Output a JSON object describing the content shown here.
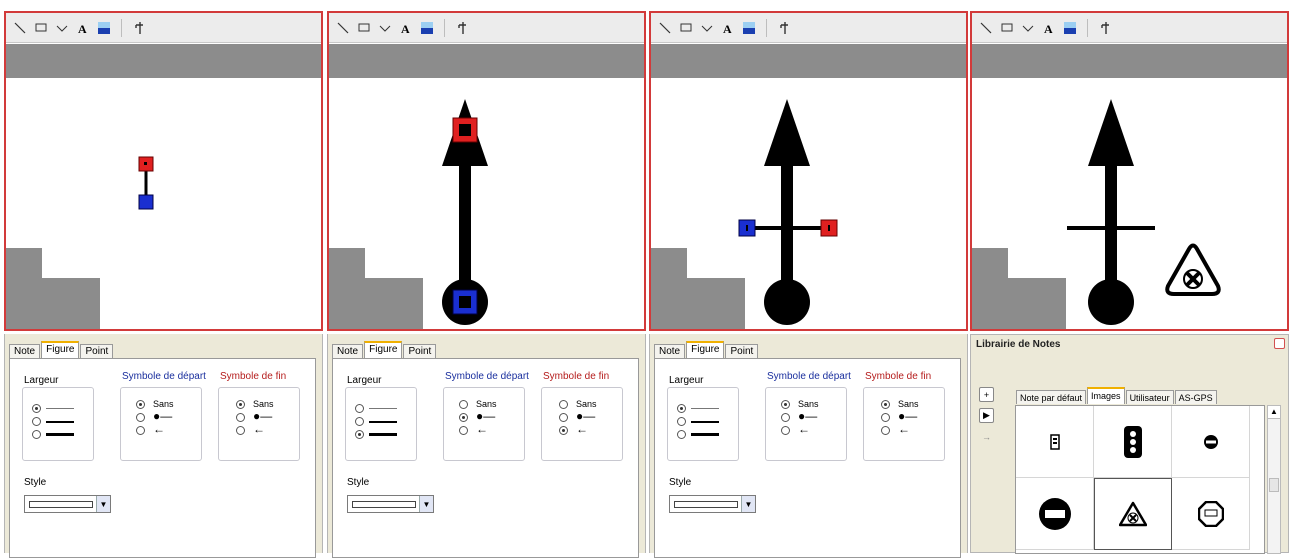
{
  "toolbar_icons": [
    "line-tool-icon",
    "rectangle-tool-icon",
    "curve-tool-icon",
    "text-tool-icon",
    "fill-color-icon",
    "anchor-tool-icon"
  ],
  "panels": [
    {
      "tabs": [
        "Note",
        "Figure",
        "Point"
      ],
      "active_tab": "Figure",
      "largeur_label": "Largeur",
      "symbole_depart_label": "Symbole de départ",
      "symbole_fin_label": "Symbole de fin",
      "sans_label": "Sans",
      "style_label": "Style",
      "largeur_selected": 0,
      "depart_selected": 0,
      "fin_selected": 0
    },
    {
      "tabs": [
        "Note",
        "Figure",
        "Point"
      ],
      "active_tab": "Figure",
      "largeur_label": "Largeur",
      "symbole_depart_label": "Symbole de départ",
      "symbole_fin_label": "Symbole de fin",
      "sans_label": "Sans",
      "style_label": "Style",
      "largeur_selected": 2,
      "depart_selected": 1,
      "fin_selected": 2
    },
    {
      "tabs": [
        "Note",
        "Figure",
        "Point"
      ],
      "active_tab": "Figure",
      "largeur_label": "Largeur",
      "symbole_depart_label": "Symbole de départ",
      "symbole_fin_label": "Symbole de fin",
      "sans_label": "Sans",
      "style_label": "Style",
      "largeur_selected": 0,
      "depart_selected": 0,
      "fin_selected": 0
    }
  ],
  "library": {
    "title": "Librairie de Notes",
    "tabs": [
      "Note par défaut",
      "Images",
      "Utilisateur",
      "AS-GPS"
    ],
    "active_tab": "Images",
    "icons": [
      "traffic-sign-small-icon",
      "traffic-light-icon",
      "no-entry-small-icon",
      "no-entry-icon",
      "hazard-x-icon",
      "stop-sign-icon"
    ]
  }
}
